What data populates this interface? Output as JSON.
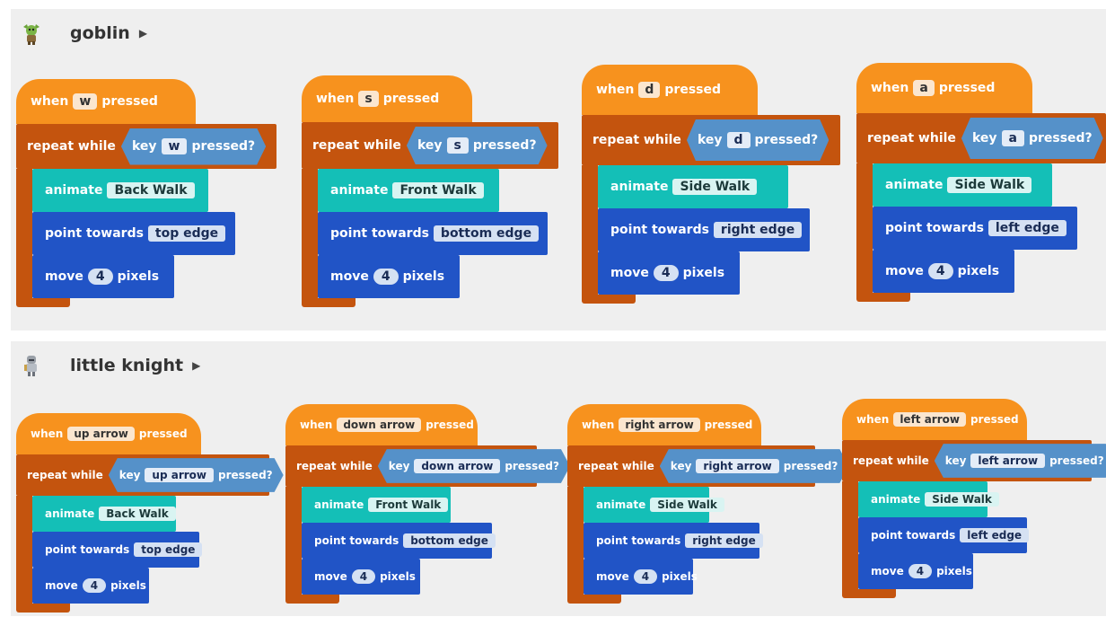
{
  "sprites": [
    {
      "name": "goblin",
      "scripts": [
        {
          "key": "w",
          "costume": "Back Walk",
          "direction": "top edge",
          "steps": "4"
        },
        {
          "key": "s",
          "costume": "Front Walk",
          "direction": "bottom edge",
          "steps": "4"
        },
        {
          "key": "d",
          "costume": "Side Walk",
          "direction": "right edge",
          "steps": "4"
        },
        {
          "key": "a",
          "costume": "Side Walk",
          "direction": "left edge",
          "steps": "4"
        }
      ]
    },
    {
      "name": "little knight",
      "scripts": [
        {
          "key": "up arrow",
          "costume": "Back Walk",
          "direction": "top edge",
          "steps": "4"
        },
        {
          "key": "down arrow",
          "costume": "Front Walk",
          "direction": "bottom edge",
          "steps": "4"
        },
        {
          "key": "right arrow",
          "costume": "Side Walk",
          "direction": "right edge",
          "steps": "4"
        },
        {
          "key": "left arrow",
          "costume": "Side Walk",
          "direction": "left edge",
          "steps": "4"
        }
      ]
    }
  ],
  "labels": {
    "when": "when",
    "pressed": "pressed",
    "repeat_while": "repeat while",
    "key": "key",
    "pressed_q": "pressed?",
    "animate": "animate",
    "point_towards": "point towards",
    "move": "move",
    "pixels": "pixels"
  },
  "colors": {
    "event_hat": "#f7921e",
    "control_loop": "#c4540e",
    "sensing_boolean": "#5591c9",
    "looks_animate": "#14bfb7",
    "motion": "#2154c6"
  },
  "icons": {
    "goblin_avatar": "goblin-sprite-icon",
    "knight_avatar": "knight-sprite-icon",
    "expand": "triangle-right-icon"
  }
}
